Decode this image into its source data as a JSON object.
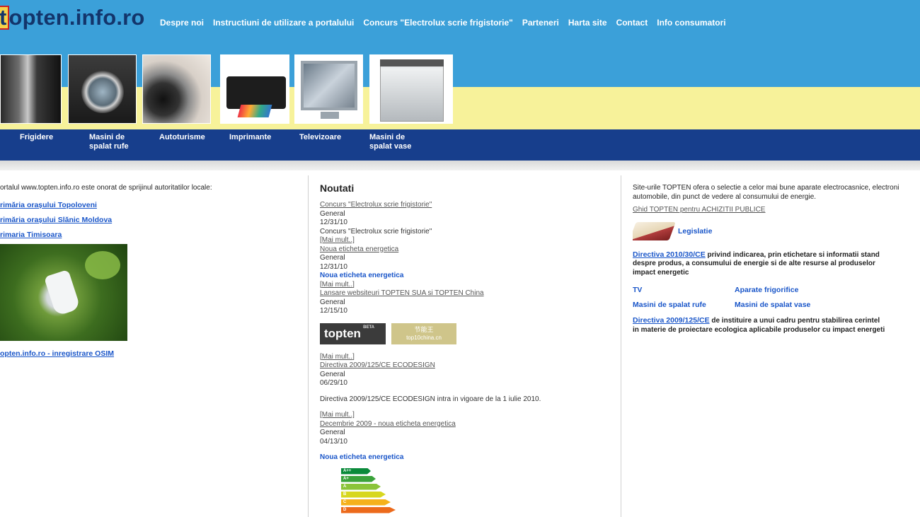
{
  "header": {
    "logo_highlight": "t",
    "logo_rest": "opten.info.ro",
    "nav": [
      "Despre noi",
      "Instructiuni de utilizare a portalului",
      "Concurs \"Electrolux scrie frigistorie\"",
      "Parteneri",
      "Harta site",
      "Contact",
      "Info consumatori"
    ]
  },
  "categories": [
    {
      "line1": "Frigidere",
      "line2": ""
    },
    {
      "line1": "Masini de",
      "line2": "spalat rufe"
    },
    {
      "line1": "Autoturisme",
      "line2": ""
    },
    {
      "line1": "Imprimante",
      "line2": ""
    },
    {
      "line1": "Televizoare",
      "line2": ""
    },
    {
      "line1": "Masini de",
      "line2": "spalat vase"
    }
  ],
  "left": {
    "intro": "ortalul www.topten.info.ro este onorat de sprijinul autoritatilor locale:",
    "links": [
      "rimăria orașului Topoloveni",
      "rimăria orașului Slănic Moldova",
      "rimaria Timisoara "
    ],
    "osim": "opten.info.ro - inregistrare OSIM"
  },
  "mid": {
    "heading": "Noutati",
    "news": [
      {
        "title": "Concurs \"Electrolux scrie frigistorie\"",
        "cat": "General",
        "date": "12/31/10",
        "body": "Concurs \"Electrolux scrie frigistorie\"",
        "more": "[Mai mult..]"
      },
      {
        "title": "Noua eticheta energetica",
        "cat": "General",
        "date": "12/31/10",
        "body": "Noua eticheta energetica",
        "more": "[Mai mult..]"
      },
      {
        "title": "Lansare websiteuri TOPTEN SUA si TOPTEN China",
        "cat": "General",
        "date": "12/15/10",
        "more": "[Mai mult..]"
      },
      {
        "title": "Directiva 2009/125/CE ECODESIGN",
        "cat": "General",
        "date": "06/29/10",
        "body": "Directiva 2009/125/CE ECODESIGN intra in vigoare de la 1 iulie 2010.",
        "more": "[Mai mult..]"
      },
      {
        "title": "Decembrie 2009 - noua eticheta energetica",
        "cat": "General",
        "date": "04/13/10",
        "body": "Noua eticheta energetica"
      }
    ],
    "logo_us_text": "topten",
    "logo_us_badge": "BETA",
    "logo_cn_top": "节能王",
    "logo_cn_bottom": "top10china.cn",
    "energy_labels": [
      "A++",
      "A+",
      "A",
      "B",
      "C",
      "D"
    ],
    "energy_colors": [
      "#0a8a3a",
      "#3aa23a",
      "#8bc43a",
      "#d7d71f",
      "#f5b11c",
      "#ec6a1b"
    ]
  },
  "right": {
    "intro1": "Site-urile TOPTEN ofera o selectie a celor mai bune aparate electrocasnice, electroni",
    "intro2": "automobile, din punct de vedere al consumului de energie.",
    "ghid": "Ghid TOPTEN pentru ACHIZITII PUBLICE",
    "legislatie": "Legislatie",
    "dir1_link": "Directiva 2010/30/CE",
    "dir1_text1": " privind indicarea, prin etichetare si informatii stand",
    "dir1_text2": "despre produs, a consumului de energie si de alte resurse al produselor",
    "dir1_text3": "impact energetic",
    "links": [
      "TV",
      "Aparate frigorifice",
      "Masini de spalat rufe",
      "Masini de spalat vase"
    ],
    "dir2_link": "Directiva 2009/125/CE",
    "dir2_text1": " de instituire a unui cadru pentru stabilirea cerintel",
    "dir2_text2": "in materie de proiectare ecologica aplicabile produselor cu impact energeti"
  }
}
